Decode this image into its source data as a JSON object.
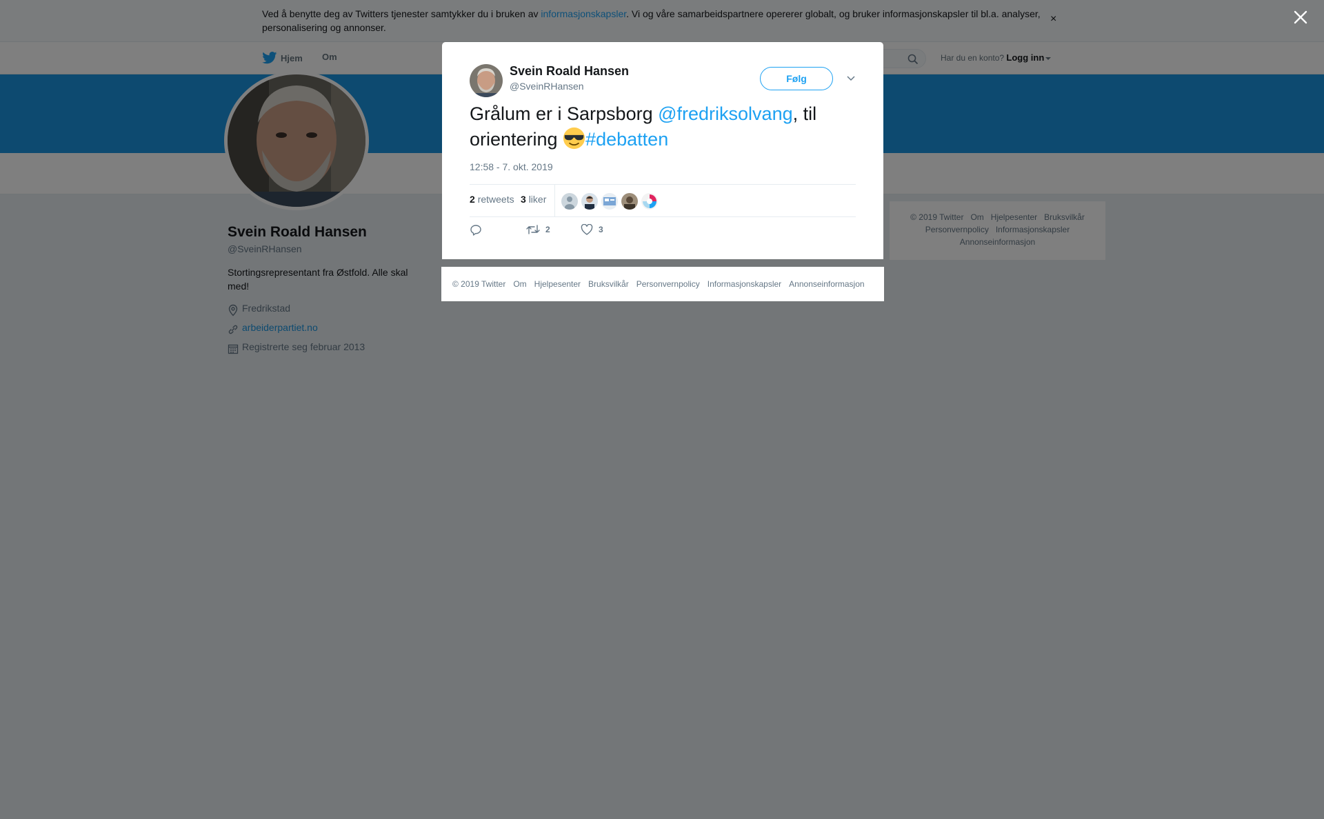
{
  "cookie": {
    "text_before": "Ved å benytte deg av Twitters tjenester samtykker du i bruken av ",
    "link": "informasjonskapsler",
    "text_after": ". Vi og våre samarbeidspartnere opererer globalt, og bruker informasjonskapsler til bl.a. analyser, personalisering og annonser.",
    "close": "×"
  },
  "nav": {
    "home": "Hjem",
    "about": "Om",
    "account_prompt": "Har du en konto?",
    "login": "Logg inn"
  },
  "profile": {
    "name": "Svein Roald Hansen",
    "handle": "@SveinRHansen",
    "bio": "Stortingsrepresentant fra Østfold. Alle skal med!",
    "location": "Fredrikstad",
    "website": "arbeiderpartiet.no",
    "joined": "Registrerte seg februar 2013"
  },
  "side_footer": {
    "items": [
      "© 2019 Twitter",
      "Om",
      "Hjelpesenter",
      "Bruksvilkår",
      "Personvernpolicy",
      "Informasjonskapsler",
      "Annonseinformasjon"
    ]
  },
  "tweet": {
    "author_name": "Svein Roald Hansen",
    "author_handle": "@SveinRHansen",
    "follow_label": "Følg",
    "text_part1": "Grålum er i Sarpsborg ",
    "mention": "@fredriksolvang",
    "text_part2": ", til orientering ",
    "hashtag": "#debatten",
    "timestamp": "12:58 - 7. okt. 2019",
    "retweets_count": "2",
    "retweets_label": "retweets",
    "likes_count": "3",
    "likes_label": "liker",
    "action_retweets": "2",
    "action_likes": "3"
  },
  "modal_footer": {
    "items": [
      "© 2019 Twitter",
      "Om",
      "Hjelpesenter",
      "Bruksvilkår",
      "Personvernpolicy",
      "Informasjonskapsler",
      "Annonseinformasjon"
    ]
  },
  "colors": {
    "accent": "#1da1f2",
    "banner": "#1b95e0",
    "overlay": "rgba(0,0,0,0.5)"
  },
  "icons": {
    "nav_home": "twitter-bird-icon",
    "search": "search-icon",
    "location": "location-pin-icon",
    "link": "link-icon",
    "calendar": "calendar-icon",
    "close_overlay": "close-icon",
    "tweet_menu": "chevron-down-icon",
    "reply": "reply-icon",
    "retweet": "retweet-icon",
    "like": "heart-icon"
  }
}
